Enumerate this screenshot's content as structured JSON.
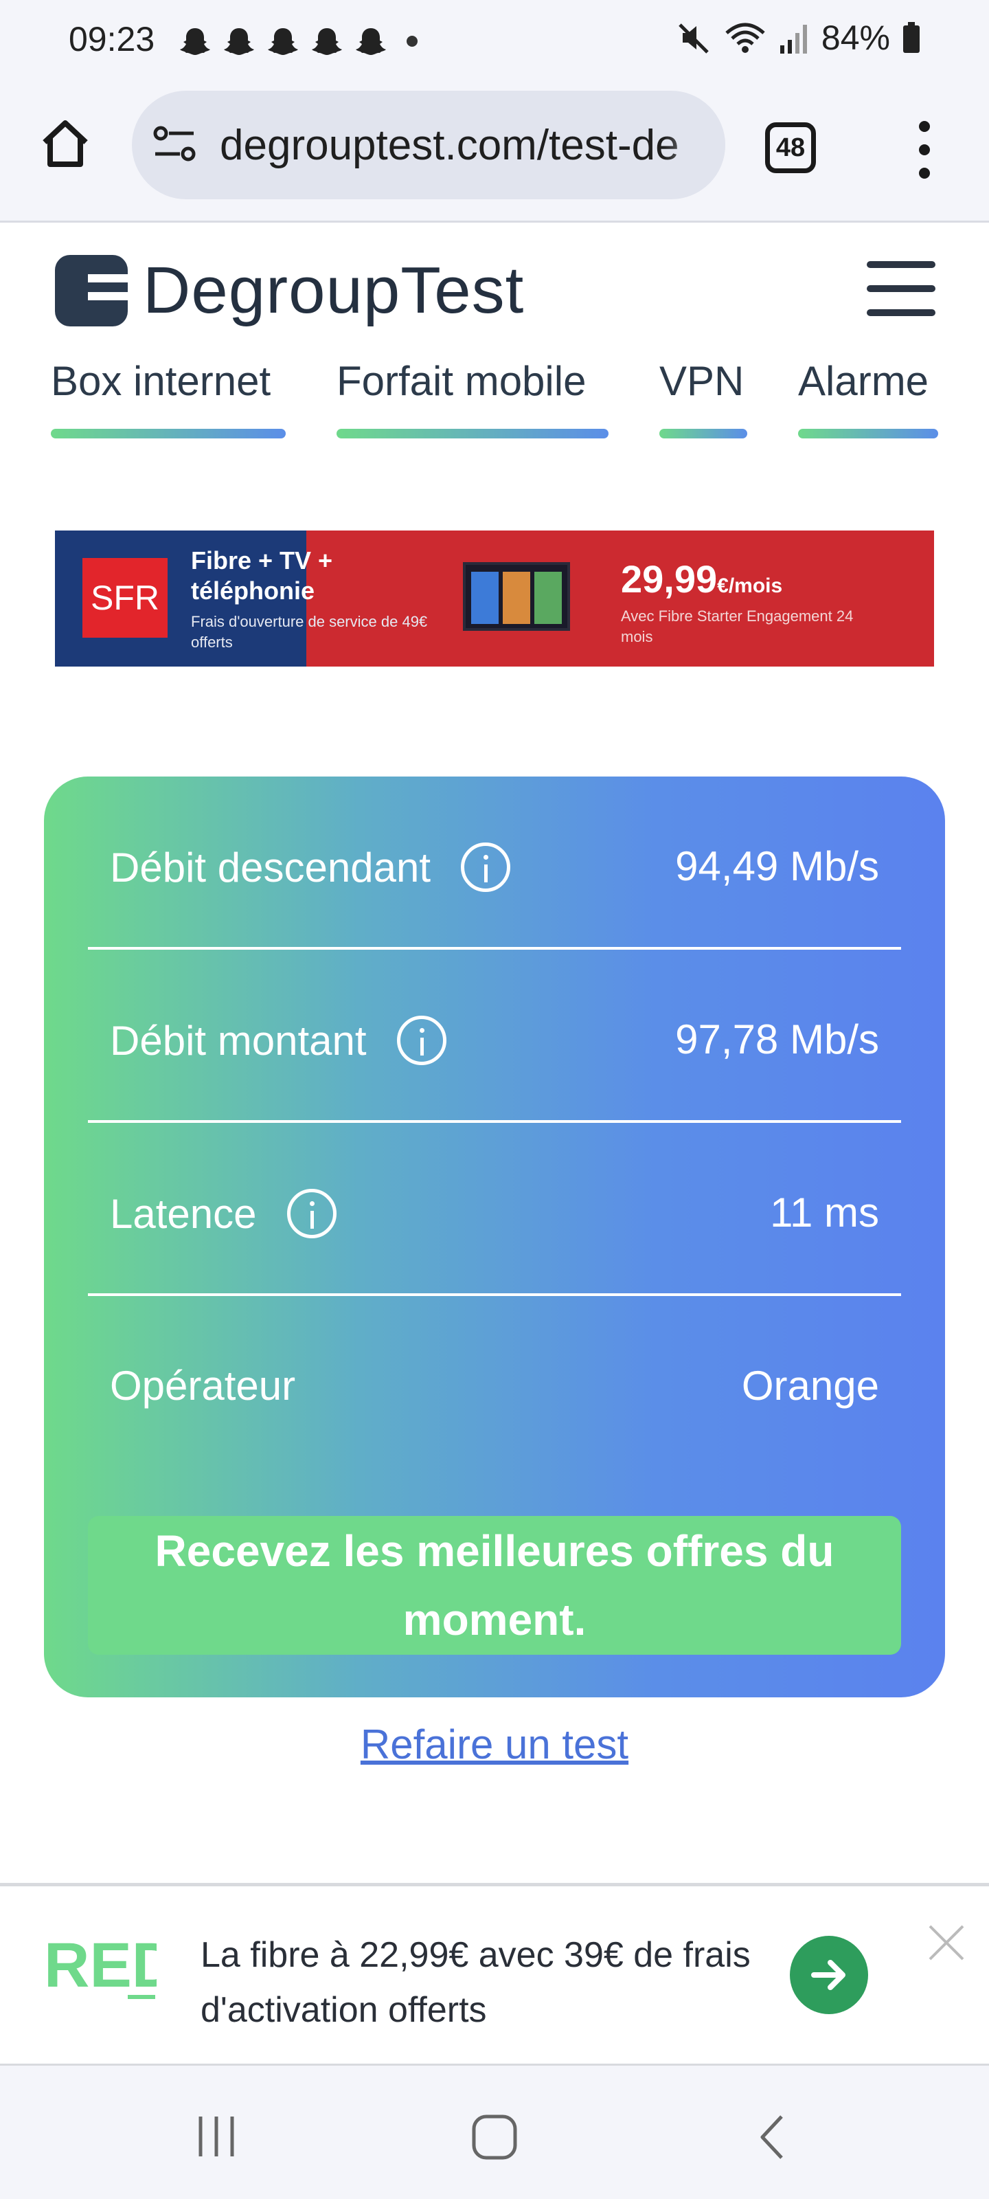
{
  "status_bar": {
    "time": "09:23",
    "battery": "84%",
    "notification_icons": [
      "snapchat-icon",
      "snapchat-icon",
      "snapchat-icon",
      "snapchat-icon",
      "snapchat-icon"
    ]
  },
  "browser": {
    "url": "degrouptest.com/test-de",
    "tab_count": "48"
  },
  "site": {
    "logo_text": "DegroupTest",
    "nav": [
      {
        "label": "Box internet"
      },
      {
        "label": "Forfait mobile"
      },
      {
        "label": "VPN"
      },
      {
        "label": "Alarme"
      }
    ]
  },
  "top_ad": {
    "brand": "SFR",
    "title": "Fibre + TV + téléphonie",
    "subtitle": "Frais d'ouverture de service de 49€ offerts",
    "price": "29,99",
    "price_unit": "€/mois",
    "price_note": "Avec Fibre Starter Engagement 24 mois"
  },
  "results": {
    "rows": [
      {
        "label": "Débit descendant",
        "value": "94,49 Mb/s"
      },
      {
        "label": "Débit montant",
        "value": "97,78 Mb/s"
      },
      {
        "label": "Latence",
        "value": "11 ms"
      },
      {
        "label": "Opérateur",
        "value": "Orange"
      }
    ],
    "cta_label": "Recevez les meilleures offres du moment.",
    "retest_label": "Refaire un test"
  },
  "bottom_ad": {
    "text": "La fibre à 22,99€ avec 39€ de frais d'activation offerts"
  },
  "colors": {
    "gradient_start": "#6fd98b",
    "gradient_end": "#5b82ee",
    "cta_green": "#6fd98b",
    "link_blue": "#4a72d8"
  }
}
